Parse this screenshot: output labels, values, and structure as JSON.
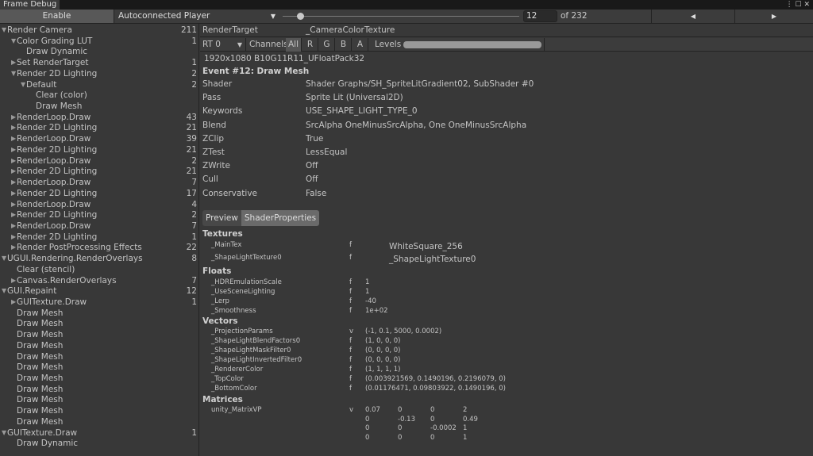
{
  "window": {
    "tab": "Frame Debug",
    "icons": "⋮ ☐ ✕"
  },
  "toolbar": {
    "enable": "Enable",
    "player": "Autoconnected Player",
    "frame": "12",
    "of_total": "of 232",
    "prev": "◀",
    "next": "▶",
    "slider_fraction": 0.05
  },
  "tree": [
    {
      "l": 0,
      "a": "▼",
      "t": "Render Camera",
      "c": "211"
    },
    {
      "l": 1,
      "a": "▼",
      "t": "Color Grading LUT",
      "c": "1"
    },
    {
      "l": 2,
      "a": "",
      "t": "Draw Dynamic",
      "c": ""
    },
    {
      "l": 1,
      "a": "▶",
      "t": "Set RenderTarget",
      "c": "1"
    },
    {
      "l": 1,
      "a": "▼",
      "t": "Render 2D Lighting",
      "c": "2"
    },
    {
      "l": 2,
      "a": "▼",
      "t": "Default",
      "c": "2"
    },
    {
      "l": 3,
      "a": "",
      "t": "Clear (color)",
      "c": ""
    },
    {
      "l": 3,
      "a": "",
      "t": "Draw Mesh",
      "c": ""
    },
    {
      "l": 1,
      "a": "▶",
      "t": "RenderLoop.Draw",
      "c": "43"
    },
    {
      "l": 1,
      "a": "▶",
      "t": "Render 2D Lighting",
      "c": "21"
    },
    {
      "l": 1,
      "a": "▶",
      "t": "RenderLoop.Draw",
      "c": "39"
    },
    {
      "l": 1,
      "a": "▶",
      "t": "Render 2D Lighting",
      "c": "21"
    },
    {
      "l": 1,
      "a": "▶",
      "t": "RenderLoop.Draw",
      "c": "2"
    },
    {
      "l": 1,
      "a": "▶",
      "t": "Render 2D Lighting",
      "c": "21"
    },
    {
      "l": 1,
      "a": "▶",
      "t": "RenderLoop.Draw",
      "c": "7"
    },
    {
      "l": 1,
      "a": "▶",
      "t": "Render 2D Lighting",
      "c": "17"
    },
    {
      "l": 1,
      "a": "▶",
      "t": "RenderLoop.Draw",
      "c": "4"
    },
    {
      "l": 1,
      "a": "▶",
      "t": "Render 2D Lighting",
      "c": "2"
    },
    {
      "l": 1,
      "a": "▶",
      "t": "RenderLoop.Draw",
      "c": "7"
    },
    {
      "l": 1,
      "a": "▶",
      "t": "Render 2D Lighting",
      "c": "1"
    },
    {
      "l": 1,
      "a": "▶",
      "t": "Render PostProcessing Effects",
      "c": "22"
    },
    {
      "l": 0,
      "a": "▼",
      "t": "UGUI.Rendering.RenderOverlays",
      "c": "8"
    },
    {
      "l": 1,
      "a": "",
      "t": "Clear (stencil)",
      "c": ""
    },
    {
      "l": 1,
      "a": "▶",
      "t": "Canvas.RenderOverlays",
      "c": "7"
    },
    {
      "l": 0,
      "a": "▼",
      "t": "GUI.Repaint",
      "c": "12"
    },
    {
      "l": 1,
      "a": "▶",
      "t": "GUITexture.Draw",
      "c": "1"
    },
    {
      "l": 1,
      "a": "",
      "t": "Draw Mesh",
      "c": ""
    },
    {
      "l": 1,
      "a": "",
      "t": "Draw Mesh",
      "c": ""
    },
    {
      "l": 1,
      "a": "",
      "t": "Draw Mesh",
      "c": ""
    },
    {
      "l": 1,
      "a": "",
      "t": "Draw Mesh",
      "c": ""
    },
    {
      "l": 1,
      "a": "",
      "t": "Draw Mesh",
      "c": ""
    },
    {
      "l": 1,
      "a": "",
      "t": "Draw Mesh",
      "c": ""
    },
    {
      "l": 1,
      "a": "",
      "t": "Draw Mesh",
      "c": ""
    },
    {
      "l": 1,
      "a": "",
      "t": "Draw Mesh",
      "c": ""
    },
    {
      "l": 1,
      "a": "",
      "t": "Draw Mesh",
      "c": ""
    },
    {
      "l": 1,
      "a": "",
      "t": "Draw Mesh",
      "c": ""
    },
    {
      "l": 1,
      "a": "",
      "t": "Draw Mesh",
      "c": ""
    },
    {
      "l": 0,
      "a": "▼",
      "t": "GUITexture.Draw",
      "c": "1"
    },
    {
      "l": 1,
      "a": "",
      "t": "Draw Dynamic",
      "c": ""
    }
  ],
  "details": {
    "rt_label": "RenderTarget",
    "rt_value": "_CameraColorTexture",
    "rt_select": "RT 0",
    "channels": "Channels",
    "ch": [
      "All",
      "R",
      "G",
      "B",
      "A"
    ],
    "levels": "Levels",
    "format": "1920x1080 B10G11R11_UFloatPack32",
    "event": "Event #12: Draw Mesh",
    "props": [
      [
        "Shader",
        "Shader Graphs/SH_SpriteLitGradient02, SubShader #0"
      ],
      [
        "Pass",
        "Sprite Lit (Universal2D)"
      ],
      [
        "Keywords",
        "USE_SHAPE_LIGHT_TYPE_0"
      ],
      [
        "Blend",
        "SrcAlpha OneMinusSrcAlpha, One OneMinusSrcAlpha"
      ],
      [
        "ZClip",
        "True"
      ],
      [
        "ZTest",
        "LessEqual"
      ],
      [
        "ZWrite",
        "Off"
      ],
      [
        "Cull",
        "Off"
      ],
      [
        "Conservative",
        "False"
      ]
    ],
    "tabs": [
      "Preview",
      "ShaderProperties"
    ]
  },
  "shader": {
    "textures_h": "Textures",
    "textures": [
      [
        "_MainTex",
        "f",
        "WhiteSquare_256"
      ],
      [
        "_ShapeLightTexture0",
        "f",
        "_ShapeLightTexture0"
      ]
    ],
    "floats_h": "Floats",
    "floats": [
      [
        "_HDREmulationScale",
        "f",
        "1"
      ],
      [
        "_UseSceneLighting",
        "f",
        "1"
      ],
      [
        "_Lerp",
        "f",
        "-40"
      ],
      [
        "_Smoothness",
        "f",
        "1e+02"
      ]
    ],
    "vectors_h": "Vectors",
    "vectors": [
      [
        "_ProjectionParams",
        "v",
        "(-1, 0.1, 5000, 0.0002)"
      ],
      [
        "_ShapeLightBlendFactors0",
        "f",
        "(1, 0, 0, 0)"
      ],
      [
        "_ShapeLightMaskFilter0",
        "f",
        "(0, 0, 0, 0)"
      ],
      [
        "_ShapeLightInvertedFilter0",
        "f",
        "(0, 0, 0, 0)"
      ],
      [
        "_RendererColor",
        "f",
        "(1, 1, 1, 1)"
      ],
      [
        "_TopColor",
        "f",
        "(0.003921569, 0.1490196, 0.2196079, 0)"
      ],
      [
        "_BottomColor",
        "f",
        "(0.01176471, 0.09803922, 0.1490196, 0)"
      ]
    ],
    "matrices_h": "Matrices",
    "matrix_name": "unity_MatrixVP",
    "matrix_type": "v",
    "matrix": [
      [
        "0.07",
        "0",
        "0",
        "2"
      ],
      [
        "0",
        "-0.13",
        "0",
        "0.49"
      ],
      [
        "0",
        "0",
        "-0.0002",
        "1"
      ],
      [
        "0",
        "0",
        "0",
        "1"
      ]
    ]
  }
}
